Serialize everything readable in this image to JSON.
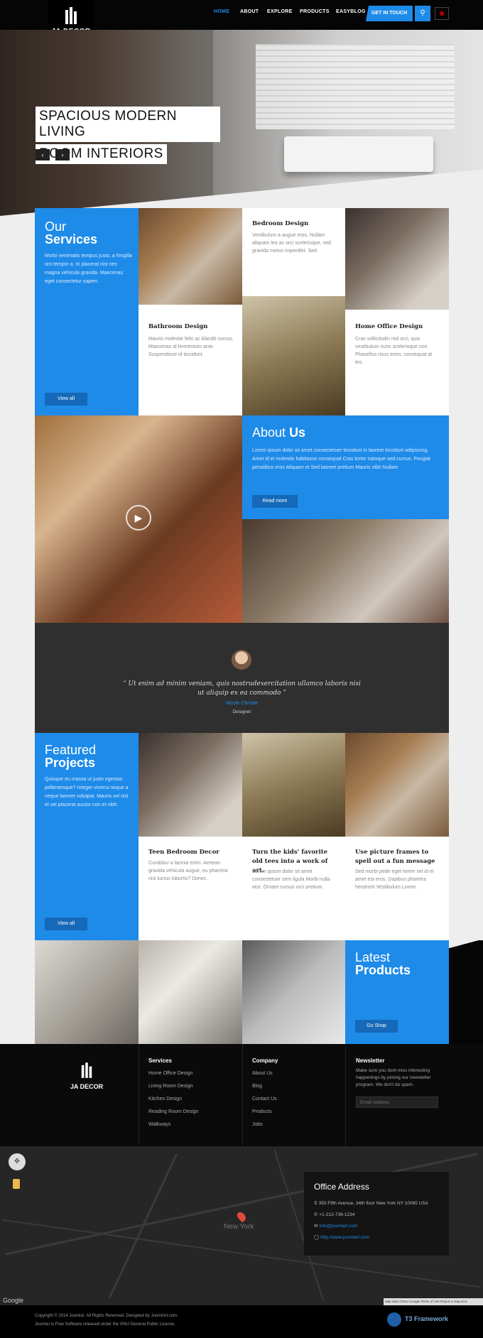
{
  "header": {
    "logo_text": "JA DECOR",
    "nav": [
      "HOME",
      "ABOUT",
      "EXPLORE",
      "PRODUCTS",
      "EASYBLOG"
    ],
    "cta": "GET IN TOUCH",
    "search_icon": "search-icon",
    "flag_icon": "uk-flag-icon"
  },
  "hero": {
    "line1": "SPACIOUS MODERN LIVING",
    "line2": "ROOM INTERIORS",
    "prev": "‹",
    "next": "›"
  },
  "services": {
    "title_light": "Our",
    "title_bold": "Services",
    "text": "Morbi venenatis tempus justo, a fringilla oro tempor a. In placerat nisi nec magna vehicula gravida. Maecenas eget consectetur sapien.",
    "button": "View all",
    "cards": [
      {
        "title": "Bedroom Design",
        "text": "Vestibulum a augue eros. Nullam aliquam leo ac orci scelerisque, sed gravida metus imperdiet. Sed."
      },
      {
        "title": "Bathroom Design",
        "text": "Mauris molestie felis ac blandit cursus. Maecenas id fermentum ante. Suspendisse id tincidunt."
      },
      {
        "title": "Home Office Design",
        "text": "Cras sollicitudin nisl orci, quis vestibulum nunc scelerisque non. Phasellus risus enim, consequat at leo."
      }
    ]
  },
  "about": {
    "title_light": "About",
    "title_bold": "Us",
    "text": "Lorem ipsum dolor sit amet consectetuer tincidunt in laoreet tincidunt adipiscing. Amet id et molestie habitasse consequat Cras tortor natoque sed cursus. Feugiat penatibus eros Aliquam et Sed laoreet pretium Mauris nibh Nullam",
    "button": "Read more"
  },
  "testimonial": {
    "quote": "“ Ut enim ad minim veniam, quis nostrudexercitation ullamco laboris nisi ut aliquip ex ea commodo ”",
    "name": "Nicole Christie",
    "role": "Designer"
  },
  "projects": {
    "title_light": "Featured",
    "title_bold": "Projects",
    "text": "Quisque eu massa ut justo egestas pellentesque? Integer viverra neque a neque laoreet volutpat. Mauris vel nisl et vel placerat auctor non et nibh.",
    "button": "View all",
    "cards": [
      {
        "title": "Teen Bedroom Decor",
        "text": "Curabitur a lacinia enim. Aenean gravida vehicula augue, eu pharetra nisi luctus lobortis? Donec."
      },
      {
        "title": "Turn the kids' favorite old tees into a work of art.",
        "text": "Lorem ipsum dolor sit amet consectetuer sem ligula Morbi nulla wisi. Ornare cursus orci pretium."
      },
      {
        "title": "Use picture frames to spell out a fun message",
        "text": "Sed morbi pede eget lorem vel id et amet est eros. Dapibus pharetra hendrerit Vestibulum Lorem."
      }
    ]
  },
  "products": {
    "title_light": "Latest",
    "title_bold": "Products",
    "button": "Go Shop"
  },
  "footer": {
    "logo_text": "JA DECOR",
    "services_title": "Services",
    "services": [
      "Home Office Design",
      "Living Room Design",
      "Kitchen Design",
      "Reading Room Design",
      "Walkways"
    ],
    "company_title": "Company",
    "company": [
      "About Us",
      "Blog",
      "Contact Us",
      "Products",
      "Jobs"
    ],
    "newsletter_title": "Newsletter",
    "newsletter_text": "Make sure you dont miss interesting happenings by joining our newsletter program. We don't do spam.",
    "newsletter_placeholder": "Email Address"
  },
  "map": {
    "city": "New York",
    "office_title": "Office Address",
    "address": "350 Fifth Avenue, 34th floor New York NY 10065 USA",
    "phone": "+1-212-736-1234",
    "email": "info@joomlart.com",
    "web": "http://www.joomlart.com",
    "google": "Google",
    "attribution": "Map data ©2014 Google   Terms of Use   Report a map error"
  },
  "bottom": {
    "copyright": "Copyright © 2014 Joomla!. All Rights Reserved. Designed by JoomlArt.com.",
    "license": "Joomla! is Free Software released under the GNU General Public License.",
    "framework": "T3 Framework"
  }
}
